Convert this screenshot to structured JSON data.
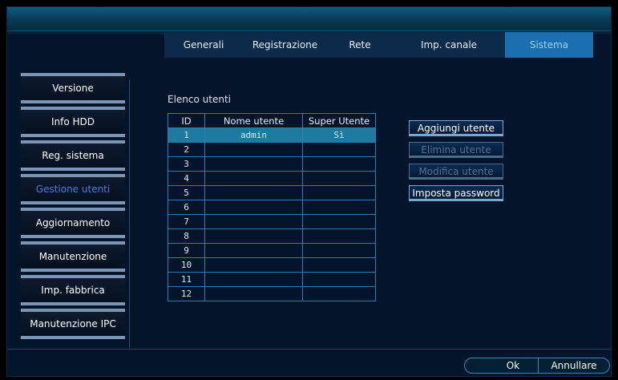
{
  "tabs": [
    {
      "label": "Generali",
      "active": false
    },
    {
      "label": "Registrazione",
      "active": false
    },
    {
      "label": "Rete",
      "active": false
    },
    {
      "label": "Imp. canale",
      "active": false
    },
    {
      "label": "Sistema",
      "active": true
    }
  ],
  "sidebar": {
    "items": [
      {
        "label": "Versione",
        "active": false
      },
      {
        "label": "Info HDD",
        "active": false
      },
      {
        "label": "Reg. sistema",
        "active": false
      },
      {
        "label": "Gestione utenti",
        "active": true
      },
      {
        "label": "Aggiornamento",
        "active": false
      },
      {
        "label": "Manutenzione",
        "active": false
      },
      {
        "label": "Imp. fabbrica",
        "active": false
      },
      {
        "label": "Manutenzione IPC",
        "active": false
      }
    ]
  },
  "users": {
    "title": "Elenco utenti",
    "columns": [
      "ID",
      "Nome utente",
      "Super Utente"
    ],
    "rows": [
      {
        "id": "1",
        "name": "admin",
        "super": "Sì",
        "selected": true
      },
      {
        "id": "2",
        "name": "",
        "super": ""
      },
      {
        "id": "3",
        "name": "",
        "super": ""
      },
      {
        "id": "4",
        "name": "",
        "super": ""
      },
      {
        "id": "5",
        "name": "",
        "super": ""
      },
      {
        "id": "6",
        "name": "",
        "super": ""
      },
      {
        "id": "7",
        "name": "",
        "super": ""
      },
      {
        "id": "8",
        "name": "",
        "super": ""
      },
      {
        "id": "9",
        "name": "",
        "super": ""
      },
      {
        "id": "10",
        "name": "",
        "super": ""
      },
      {
        "id": "11",
        "name": "",
        "super": ""
      },
      {
        "id": "12",
        "name": "",
        "super": ""
      }
    ]
  },
  "actions": {
    "add_user": "Aggiungi utente",
    "delete_user": "Elimina utente",
    "edit_user": "Modifica utente",
    "set_password": "Imposta password"
  },
  "footer": {
    "ok": "Ok",
    "cancel": "Annullare"
  }
}
